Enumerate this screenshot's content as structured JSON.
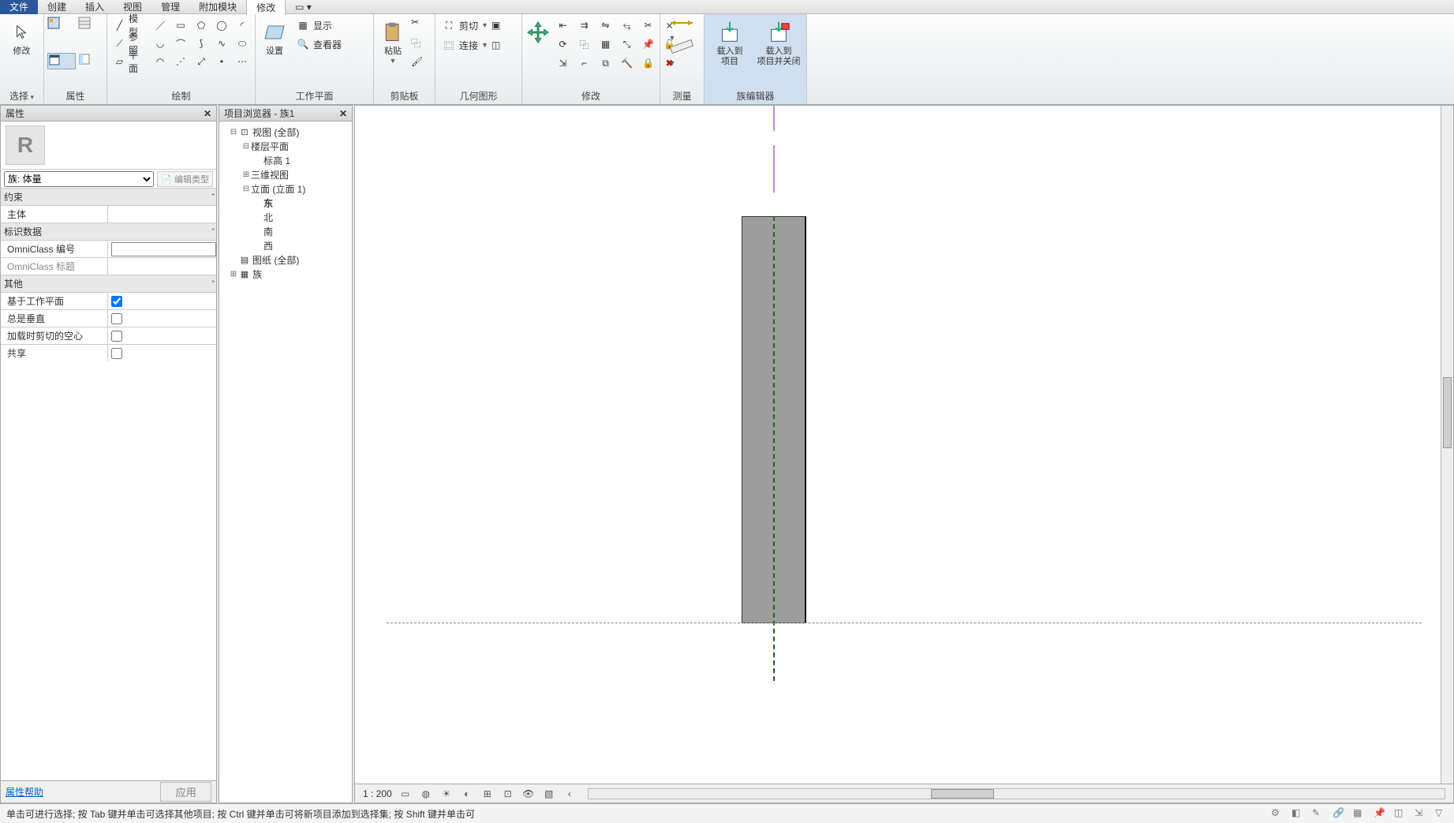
{
  "menu": {
    "file": "文件",
    "create": "创建",
    "insert": "插入",
    "view": "视图",
    "manage": "管理",
    "addins": "附加模块",
    "modify": "修改"
  },
  "ribbon": {
    "select": {
      "modify": "修改",
      "group": "选择"
    },
    "props": {
      "group": "属性"
    },
    "draw": {
      "model": "模型",
      "ref": "参照",
      "plane": "平面",
      "group": "绘制"
    },
    "wp": {
      "set": "设置",
      "show": "显示",
      "viewer": "查看器",
      "group": "工作平面"
    },
    "clip": {
      "paste": "粘贴",
      "group": "剪贴板"
    },
    "geom": {
      "cut": "剪切",
      "join": "连接",
      "group": "几何图形"
    },
    "modify": {
      "group": "修改"
    },
    "measure": {
      "group": "测量"
    },
    "fam": {
      "load": "载入到\n项目",
      "loadclose": "载入到\n项目并关闭",
      "group": "族编辑器"
    }
  },
  "propsPanel": {
    "title": "属性",
    "type": "族: 体量",
    "editType": "编辑类型",
    "groups": {
      "constraints": "约束",
      "id": "标识数据",
      "other": "其他"
    },
    "rows": {
      "host": "主体",
      "omniNum": "OmniClass 编号",
      "omniTitle": "OmniClass 标题",
      "wpBased": "基于工作平面",
      "alwaysVert": "总是垂直",
      "cutVoids": "加载时剪切的空心",
      "shared": "共享"
    },
    "help": "属性帮助",
    "apply": "应用"
  },
  "browser": {
    "title": "项目浏览器 - 族1",
    "views": "视图 (全部)",
    "floorplans": "楼层平面",
    "level1": "标高 1",
    "threeD": "三维视图",
    "elev": "立面 (立面 1)",
    "east": "东",
    "north": "北",
    "south": "南",
    "west": "西",
    "sheets": "图纸 (全部)",
    "families": "族"
  },
  "viewbar": {
    "scale": "1 : 200"
  },
  "status": {
    "hint": "单击可进行选择; 按 Tab 键并单击可选择其他项目; 按 Ctrl 键并单击可将新项目添加到选择集; 按 Shift 键并单击可"
  }
}
